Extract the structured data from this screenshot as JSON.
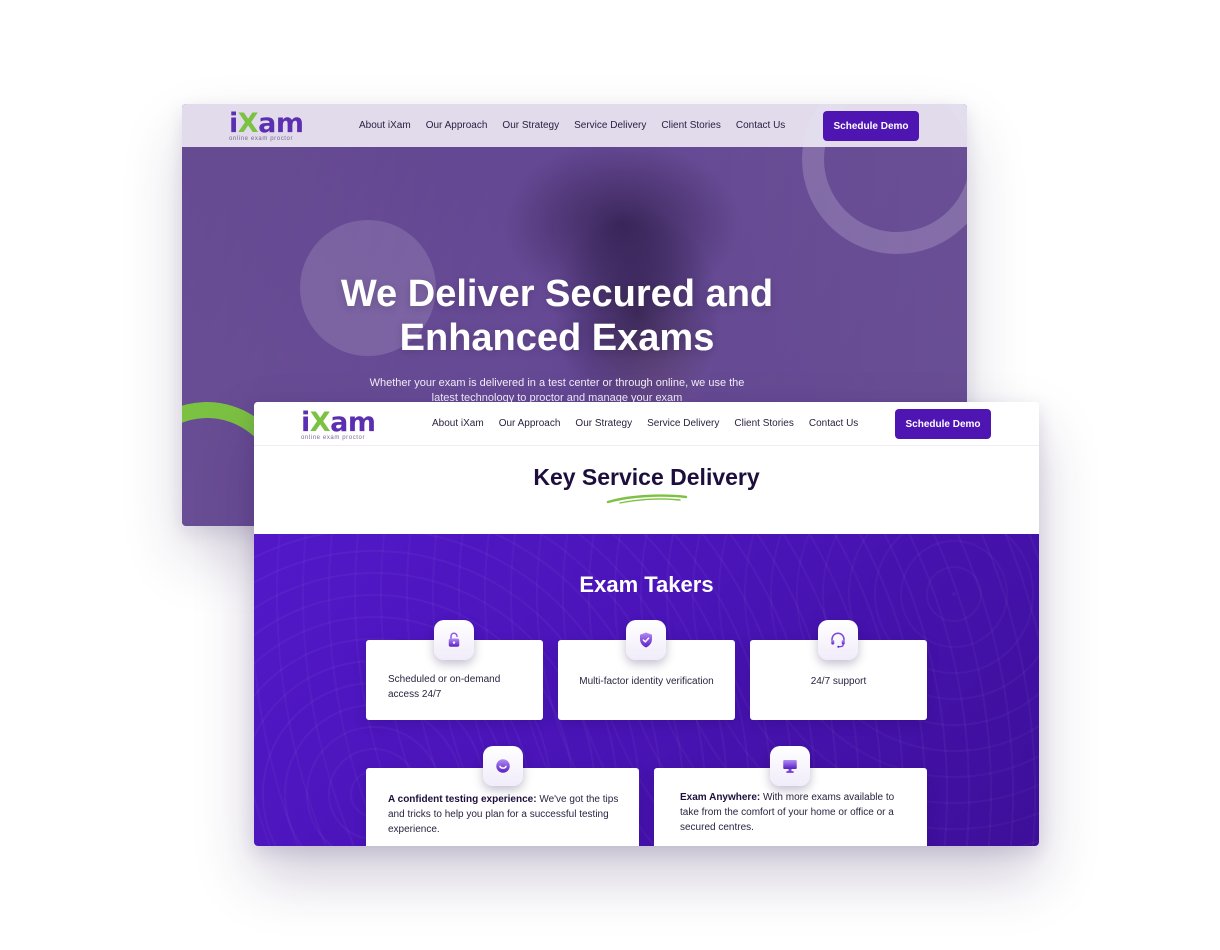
{
  "brand": {
    "logo_i": "i",
    "logo_x": "X",
    "logo_am": "am",
    "tagline": "online exam proctor"
  },
  "nav": {
    "items": [
      {
        "label": "About iXam"
      },
      {
        "label": "Our Approach"
      },
      {
        "label": "Our Strategy"
      },
      {
        "label": "Service Delivery"
      },
      {
        "label": "Client Stories"
      },
      {
        "label": "Contact Us"
      }
    ],
    "cta_label": "Schedule Demo"
  },
  "hero": {
    "title_line1": "We Deliver Secured and",
    "title_line2": "Enhanced Exams",
    "subtitle": "Whether your exam is delivered in a test center or through online, we use the latest technology to proctor and manage your exam"
  },
  "service": {
    "section_title": "Key Service Delivery",
    "group_title": "Exam Takers",
    "features": [
      {
        "icon": "unlock-icon",
        "text": "Scheduled or on-demand access 24/7"
      },
      {
        "icon": "shield-check-icon",
        "text": "Multi-factor identity verification"
      },
      {
        "icon": "headset-icon",
        "text": "24/7 support"
      }
    ],
    "wide_features": [
      {
        "icon": "smile-icon",
        "bold": "A confident testing experience:",
        "text": " We've got the tips and tricks to help you plan for a successful testing experience."
      },
      {
        "icon": "monitor-icon",
        "bold": "Exam Anywhere:",
        "text": " With more exams available to take from the comfort of your home or office or a secured centres."
      }
    ]
  },
  "colors": {
    "brand_purple": "#4e15b3",
    "brand_green": "#7cc242",
    "dark_text": "#1d0e3d"
  }
}
